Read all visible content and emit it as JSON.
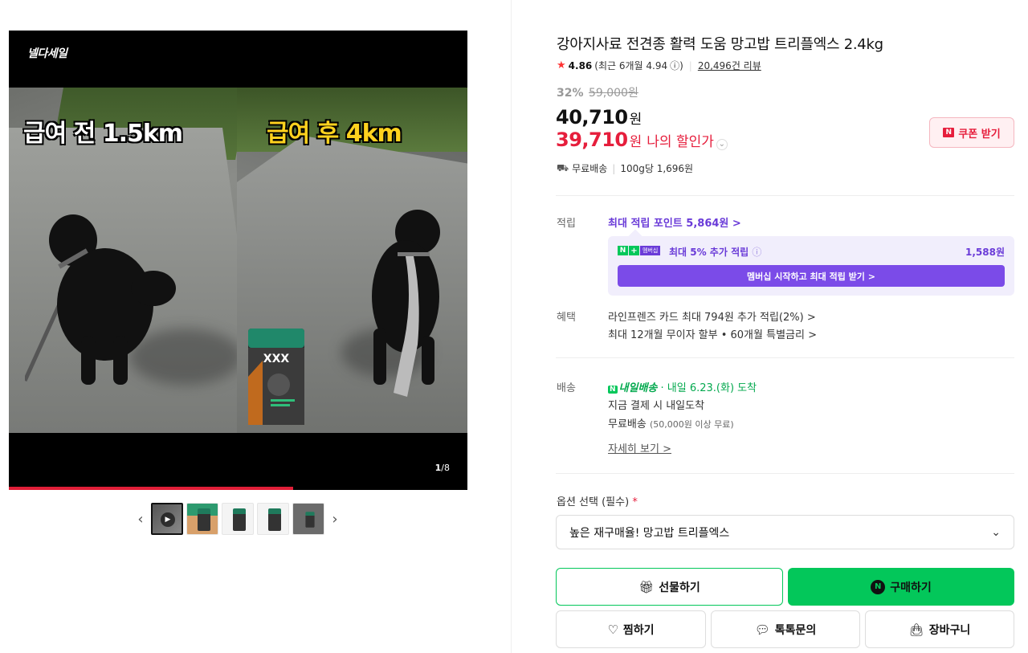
{
  "media": {
    "brand_label": "넬다세일",
    "caption_left": "급여 전 1.5km",
    "caption_right": "급여 후 4km",
    "counter_current": "1",
    "counter_total": "/8",
    "progress": 0.62,
    "bag_label": "XXX"
  },
  "thumbnails": {
    "prev_icon": "chevron-left-icon",
    "next_icon": "chevron-right-icon",
    "count": 5
  },
  "product": {
    "title": "강아지사료 전견종 활력 도움 망고밥 트리플엑스 2.4kg",
    "rating_score": "4.86",
    "rating_recent": "(최근 6개월 4.94",
    "rating_info": "ⓘ)",
    "review_count": "20,496건 리뷰",
    "discount_rate": "32%",
    "original_price": "59,000원",
    "price": "40,710",
    "price_unit": "원",
    "my_price": "39,710",
    "my_price_unit": "원",
    "my_price_label": "나의 할인가",
    "coupon_label": "쿠폰 받기",
    "shipping_free": "무료배송",
    "unit_price": "100g당 1,696원"
  },
  "points": {
    "label": "적립",
    "max_points_link": "최대 적립 포인트 5,864원 >",
    "membership_badge": "멤버십",
    "extra_text": "최대 5% 추가 적립",
    "extra_info": "ⓘ",
    "extra_amount": "1,588원",
    "membership_button": "멤버십 시작하고 최대 적립 받기 >"
  },
  "benefits": {
    "label": "혜택",
    "line1": "라인프렌즈 카드 최대 794원 추가 적립(2%) >",
    "line2": "최대 12개월 무이자 할부 • 60개월 특별금리 >"
  },
  "delivery": {
    "label": "배송",
    "nextday_logo": "내일배송",
    "nextday_text": " · 내일 6.23.(화) 도착",
    "line2": "지금 결제 시 내일도착",
    "line3_main": "무료배송 ",
    "line3_small": "(50,000원 이상 무료)",
    "detail_link": "자세히 보기 >"
  },
  "options": {
    "label": "옵션 선택 (필수)",
    "required_mark": "*",
    "selected": "높은 재구매율! 망고밥 트리플엑스"
  },
  "actions": {
    "gift": "선물하기",
    "buy": "구매하기",
    "wish": "찜하기",
    "talk": "톡톡문의",
    "cart": "장바구니"
  }
}
